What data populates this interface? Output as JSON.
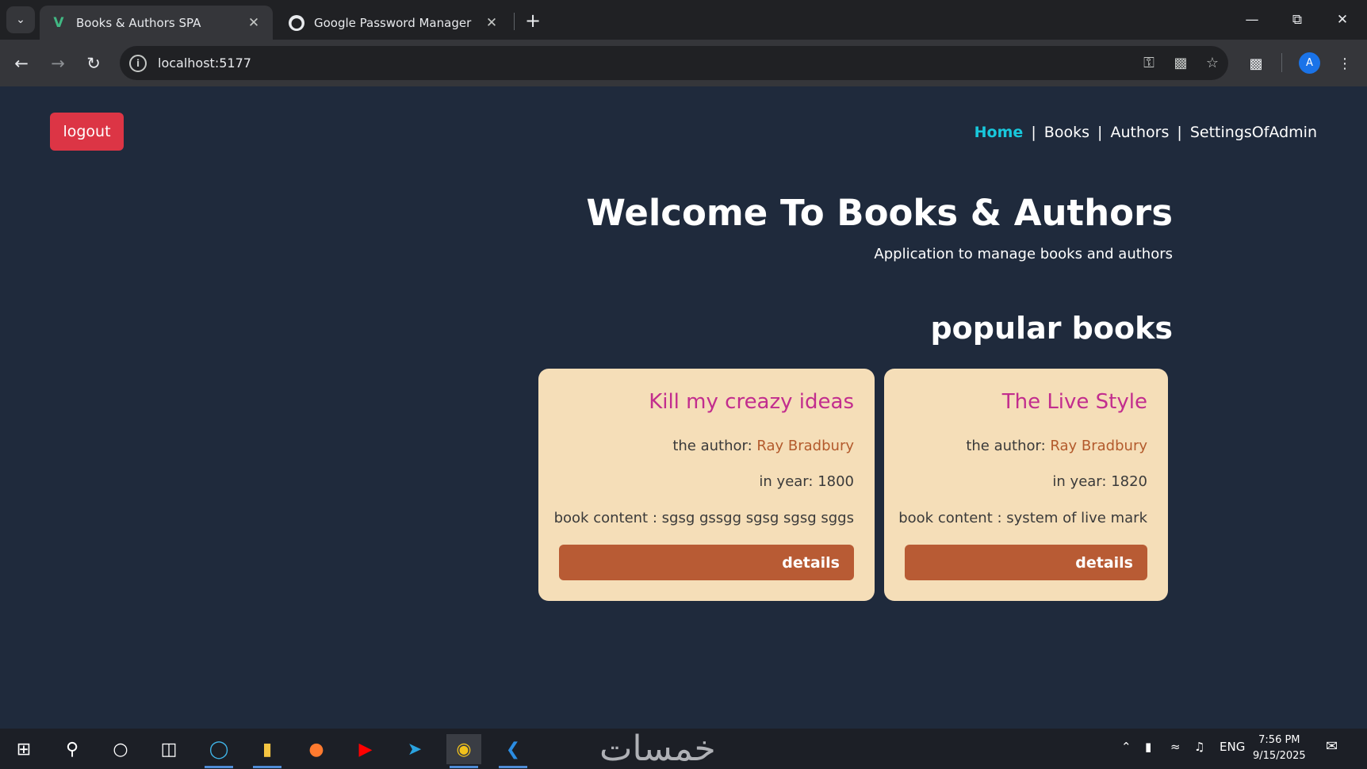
{
  "browser": {
    "tabs": [
      {
        "title": "Books & Authors SPA",
        "favicon": "vue-icon",
        "active": true
      },
      {
        "title": "Google Password Manager",
        "favicon": "password-manager-icon",
        "active": false
      }
    ],
    "new_tab_symbol": "+",
    "url": "localhost:5177",
    "profile_initial": "A"
  },
  "app": {
    "logout_label": "logout",
    "nav": [
      {
        "label": "Home",
        "active": true
      },
      {
        "label": "Books",
        "active": false
      },
      {
        "label": "Authors",
        "active": false
      },
      {
        "label": "SettingsOfAdmin",
        "active": false
      }
    ],
    "nav_separator": "|",
    "hero": {
      "title": "Welcome To Books & Authors",
      "subtitle": "Application to manage books and authors"
    },
    "popular_title": "popular books",
    "books": [
      {
        "title": "Kill my creazy ideas",
        "author_label": "the author:",
        "author": "Ray Bradbury",
        "year_label": "in year:",
        "year": "1800",
        "content_label": "book content :",
        "content": "sgsg gssgg sgsg sgsg sggs",
        "button": "details"
      },
      {
        "title": "The Live Style",
        "author_label": "the author:",
        "author": "Ray Bradbury",
        "year_label": "in year:",
        "year": "1820",
        "content_label": "book content :",
        "content": "system of live mark",
        "button": "details"
      }
    ]
  },
  "taskbar": {
    "watermark": "خمسات",
    "language": "ENG",
    "time": "7:56 PM",
    "date": "9/15/2025"
  },
  "colors": {
    "page_bg": "#1f2a3c",
    "nav_active": "#18c8dc",
    "logout_bg": "#dc3545",
    "card_bg": "#f5deb8",
    "card_title": "#c22d8e",
    "author": "#b35a2c",
    "details_bg": "#b85b34"
  }
}
